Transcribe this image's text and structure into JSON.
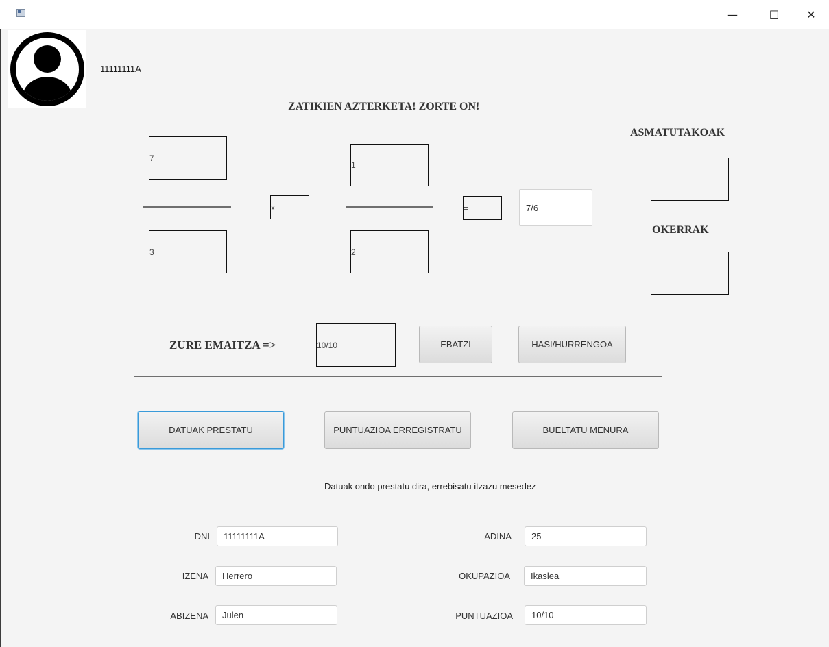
{
  "window": {
    "minimize_glyph": "—",
    "maximize_glyph": "☐",
    "close_glyph": "✕"
  },
  "user": {
    "id": "11111111A"
  },
  "header": {
    "title": "ZATIKIEN AZTERKETA! ZORTE ON!"
  },
  "exercise": {
    "fraction1": {
      "numerator": "7",
      "denominator": "3"
    },
    "operator": "x",
    "fraction2": {
      "numerator": "1",
      "denominator": "2"
    },
    "equals": "=",
    "answer": "7/6"
  },
  "scores": {
    "correct_label": "ASMATUTAKOAK",
    "correct_value": "",
    "wrong_label": "OKERRAK",
    "wrong_value": ""
  },
  "result": {
    "label": "ZURE EMAITZA =>",
    "value": "10/10",
    "solve_button": "EBATZI",
    "next_button": "HASI/HURRENGOA"
  },
  "actions": {
    "prepare": "DATUAK PRESTATU",
    "register": "PUNTUAZIOA ERREGISTRATU",
    "back": "BUELTATU MENURA"
  },
  "status": "Datuak ondo prestatu dira, errebisatu itzazu mesedez",
  "form": {
    "dni_label": "DNI",
    "dni": "11111111A",
    "izena_label": "IZENA",
    "izena": "Herrero",
    "abizena_label": "ABIZENA",
    "abizena": "Julen",
    "adina_label": "ADINA",
    "adina": "25",
    "okupazioa_label": "OKUPAZIOA",
    "okupazioa": "Ikaslea",
    "puntuazioa_label": "PUNTUAZIOA",
    "puntuazioa": "10/10"
  }
}
